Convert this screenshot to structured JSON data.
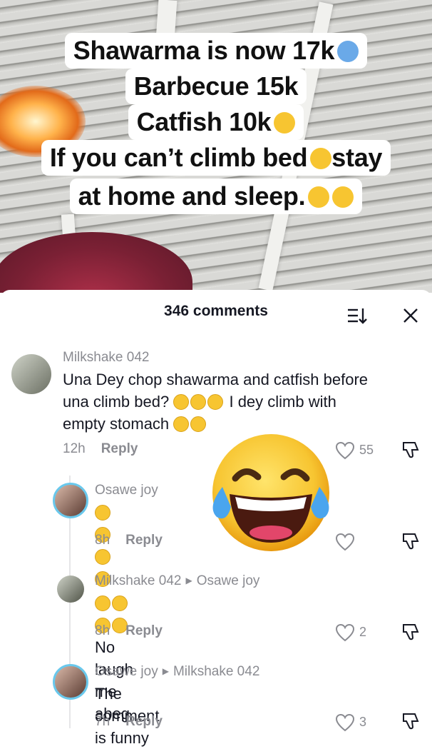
{
  "caption": {
    "lines": [
      "Shawarma is now 17k",
      "Barbecue 15k",
      "Catfish 10k",
      "If you can’t climb bed",
      "stay",
      "at home and sleep."
    ]
  },
  "comments_panel": {
    "title": "346 comments",
    "comments": [
      {
        "user": "Milkshake 042",
        "text_1": "Una Dey chop shawarma and catfish before",
        "text_2": "una climb bed?",
        "text_2b": "I dey climb with",
        "text_3": "empty stomach",
        "time": "12h",
        "reply_label": "Reply",
        "likes": "55"
      },
      {
        "user": "Osawe joy",
        "time": "8h",
        "reply_label": "Reply"
      },
      {
        "user": "Milkshake 042",
        "reply_to": "Osawe joy",
        "text": "No laugh me abeg",
        "time": "8h",
        "reply_label": "Reply",
        "likes": "2"
      },
      {
        "user": "Osawe joy",
        "reply_to": "Milkshake 042",
        "text": "The comment is funny",
        "time": "7h",
        "reply_label": "Reply",
        "likes": "3"
      }
    ]
  },
  "colors": {
    "accent_text": "#161823",
    "muted": "#8a8b91",
    "emoji_yellow": "#f7c531"
  }
}
